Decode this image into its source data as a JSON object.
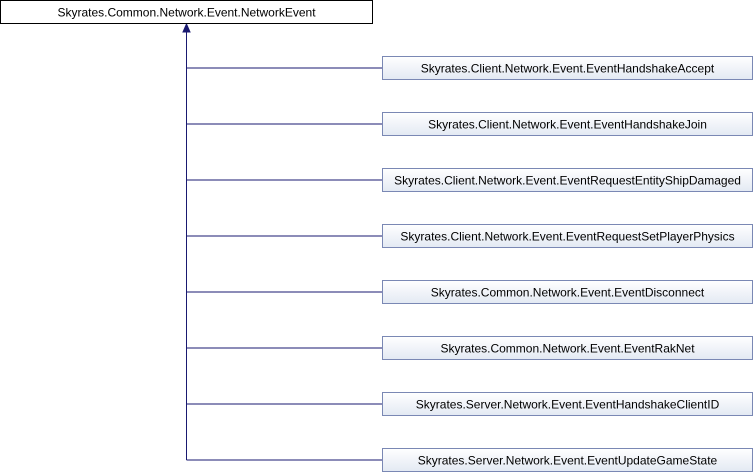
{
  "diagram": {
    "base_class": "Skyrates.Common.Network.Event.NetworkEvent",
    "derived_classes": [
      "Skyrates.Client.Network.Event.EventHandshakeAccept",
      "Skyrates.Client.Network.Event.EventHandshakeJoin",
      "Skyrates.Client.Network.Event.EventRequestEntityShipDamaged",
      "Skyrates.Client.Network.Event.EventRequestSetPlayerPhysics",
      "Skyrates.Common.Network.Event.EventDisconnect",
      "Skyrates.Common.Network.Event.EventRakNet",
      "Skyrates.Server.Network.Event.EventHandshakeClientID",
      "Skyrates.Server.Network.Event.EventUpdateGameState"
    ]
  },
  "colors": {
    "edge": "#191970",
    "derived_fill_top": "#ffffff",
    "derived_fill_bottom": "#e3e9f3",
    "derived_border": "#7a88b4",
    "base_fill": "#ffffff",
    "base_border": "#000000"
  }
}
